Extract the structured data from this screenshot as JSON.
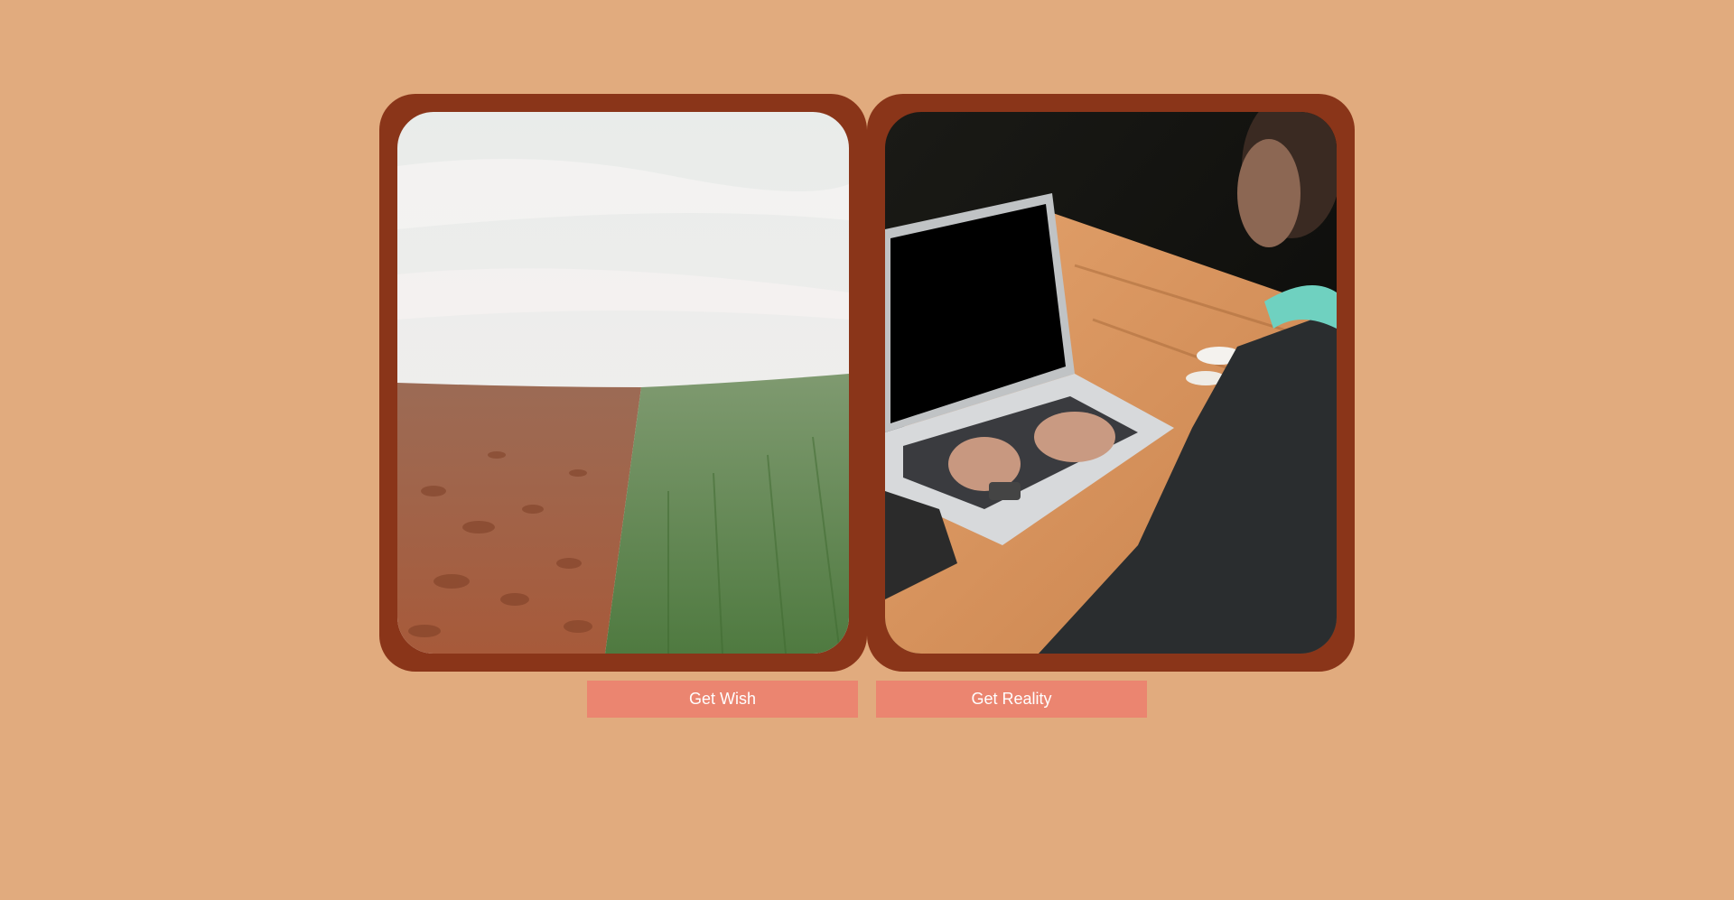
{
  "cards": [
    {
      "image": "field-landscape-photo"
    },
    {
      "image": "laptop-work-photo"
    }
  ],
  "buttons": {
    "wish_label": "Get Wish",
    "reality_label": "Get Reality"
  },
  "colors": {
    "background": "#e1ab7e",
    "frame": "#8a3519",
    "button": "#eb8570",
    "button_text": "#ffffff"
  }
}
